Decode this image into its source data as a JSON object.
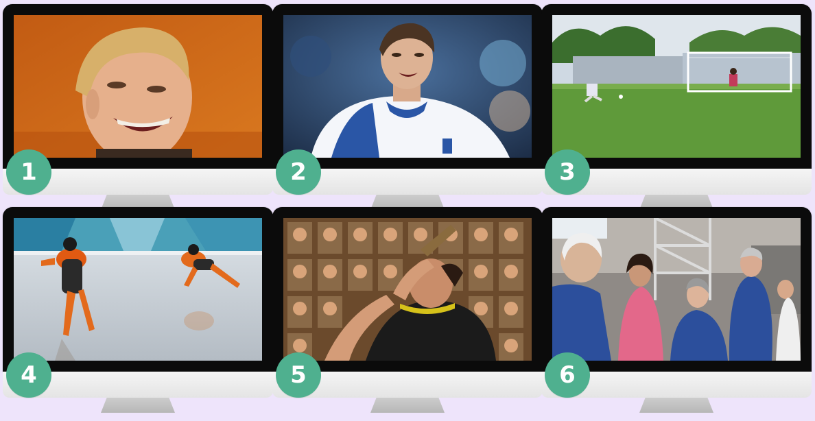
{
  "monitors": [
    {
      "number": "1",
      "image_description": "close-up-laughing-man-orange-background"
    },
    {
      "number": "2",
      "image_description": "soccer-player-in-white-jersey-smiling"
    },
    {
      "number": "3",
      "image_description": "penalty-kick-on-grass-pitch"
    },
    {
      "number": "4",
      "image_description": "two-speed-skaters-in-orange-suits"
    },
    {
      "number": "5",
      "image_description": "man-drinking-from-bottle-before-photo-wall"
    },
    {
      "number": "6",
      "image_description": "elderly-people-in-blue-shirts-in-hall"
    }
  ],
  "colors": {
    "background": "#eee4fb",
    "badge": "#4fb08f",
    "bezel": "#0b0b0b",
    "chin": "#efefef"
  }
}
